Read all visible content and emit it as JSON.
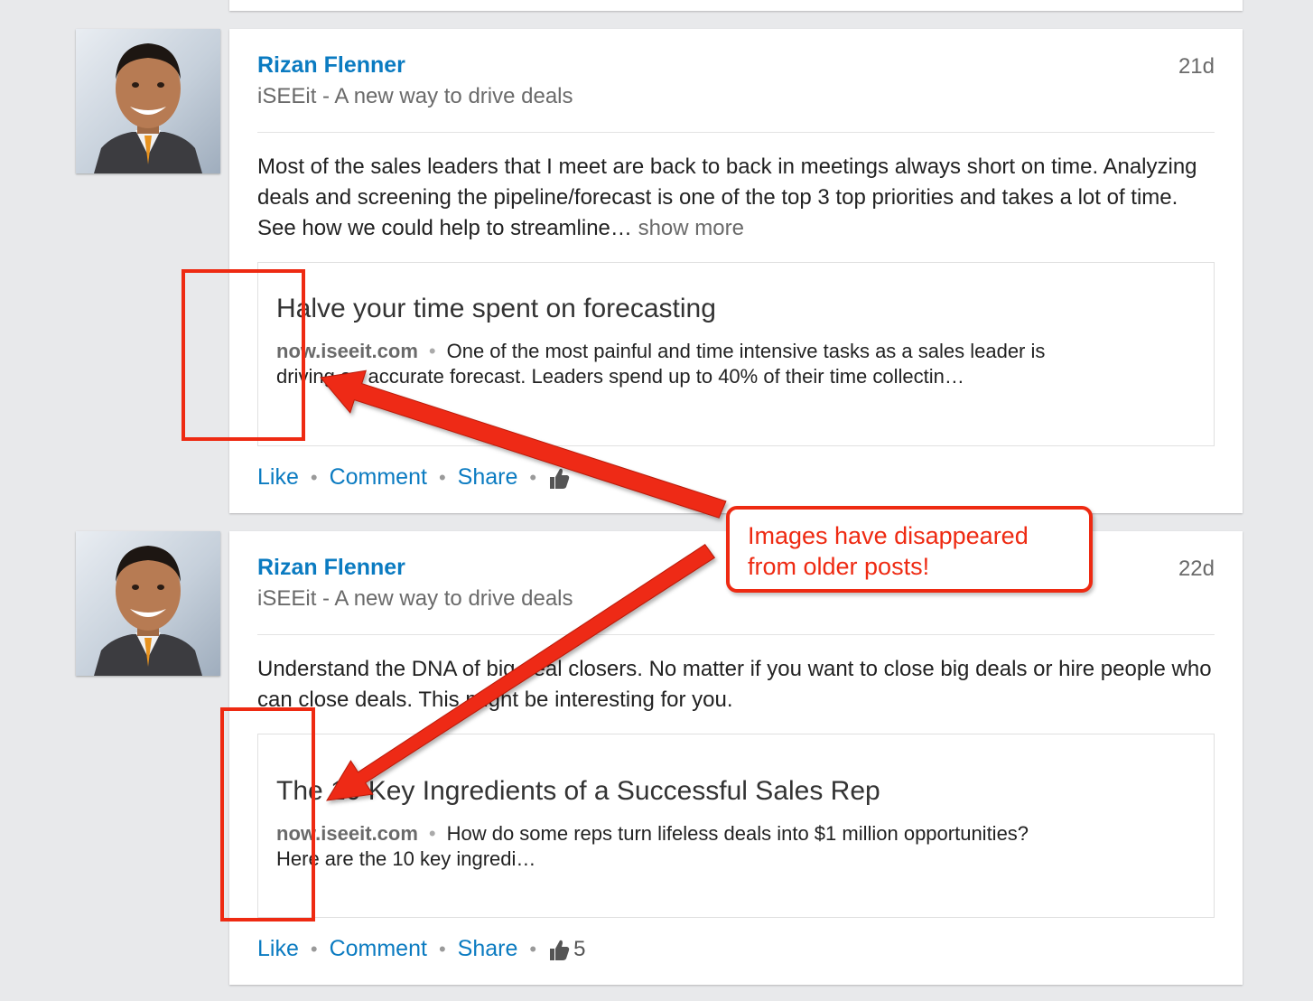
{
  "posts": [
    {
      "author": "Rizan Flenner",
      "headline": "iSEEit - A new way to drive deals",
      "time": "21d",
      "text": "Most of the sales leaders that I meet are back to back in meetings always short on time. Analyzing deals and screening the pipeline/forecast is one of the top 3 top priorities and takes a lot of time. See how we could help to streamline…",
      "show_more": "show more",
      "link": {
        "title": "Halve your time spent on forecasting",
        "domain": "now.iseeit.com",
        "description": "One of the most painful and time intensive tasks as a sales leader is driving an accurate forecast. Leaders spend up to 40% of their time collectin…"
      },
      "actions": {
        "like": "Like",
        "comment": "Comment",
        "share": "Share",
        "like_count": ""
      }
    },
    {
      "author": "Rizan Flenner",
      "headline": "iSEEit - A new way to drive deals",
      "time": "22d",
      "text": "Understand the DNA of big deal closers. No matter if you want to close big deals or hire people who can close deals. This might be interesting for you.",
      "link": {
        "title": "The 10 Key Ingredients of a Successful Sales Rep",
        "domain": "now.iseeit.com",
        "description": "How do some reps turn lifeless deals into $1 million opportunities? Here are the 10 key ingredi…"
      },
      "actions": {
        "like": "Like",
        "comment": "Comment",
        "share": "Share",
        "like_count": "5"
      }
    }
  ],
  "annotation": {
    "callout_line1": "Images have disappeared",
    "callout_line2": "from older posts!",
    "color": "#ee2a12"
  },
  "icons": {
    "thumbs_up": "thumbs-up-icon",
    "avatar": "profile-photo"
  },
  "colors": {
    "link_blue": "#0b7bc1",
    "background": "#e8e9eb"
  }
}
